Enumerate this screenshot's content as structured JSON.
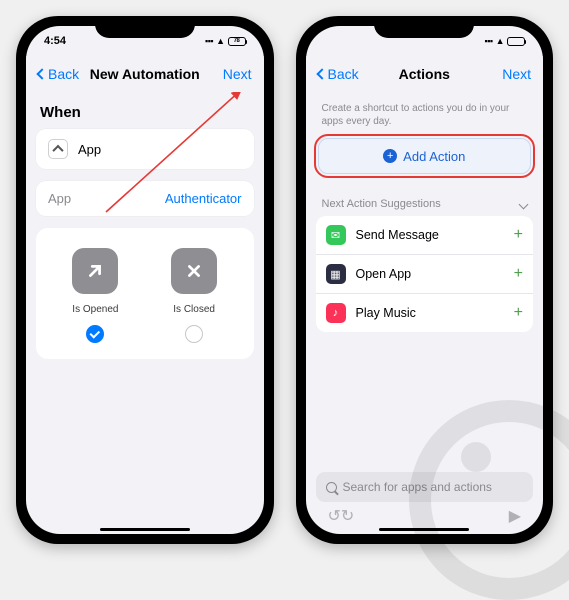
{
  "colors": {
    "accent": "#007aff",
    "highlight": "#e53935"
  },
  "phone_left": {
    "status": {
      "time": "4:54",
      "battery": "78"
    },
    "nav": {
      "back": "Back",
      "title": "New Automation",
      "next": "Next"
    },
    "when_label": "When",
    "trigger_row": {
      "label": "App"
    },
    "app_row": {
      "label": "App",
      "value": "Authenticator"
    },
    "options": [
      {
        "label": "Is Opened",
        "checked": true
      },
      {
        "label": "Is Closed",
        "checked": false
      }
    ]
  },
  "phone_right": {
    "nav": {
      "back": "Back",
      "title": "Actions",
      "next": "Next"
    },
    "intro": "Create a shortcut to actions you do in your apps every day.",
    "add_action_label": "Add Action",
    "suggestions_header": "Next Action Suggestions",
    "suggestions": [
      {
        "label": "Send Message",
        "icon_color": "#34c759"
      },
      {
        "label": "Open App",
        "icon_color": "#2b2d42"
      },
      {
        "label": "Play Music",
        "icon_color": "#fc3158"
      }
    ],
    "search_placeholder": "Search for apps and actions"
  }
}
